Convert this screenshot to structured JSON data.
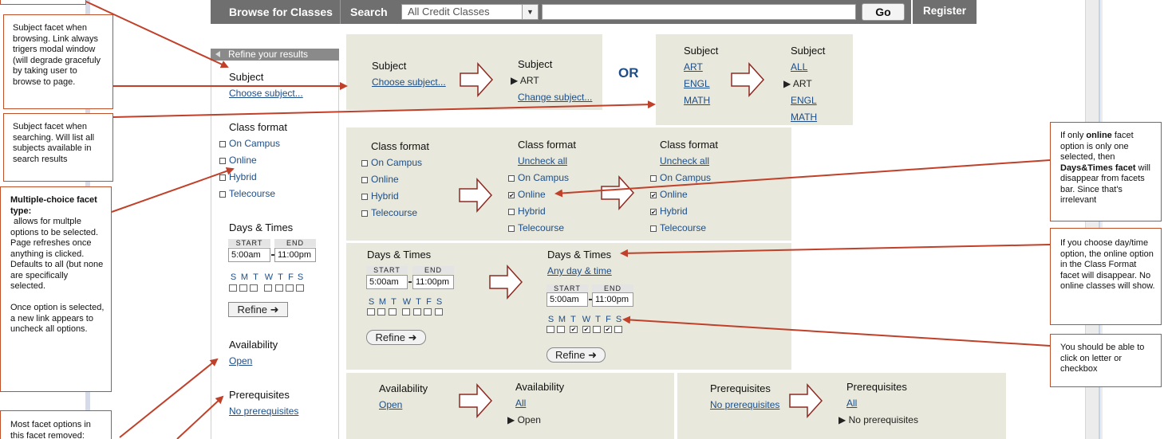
{
  "topbar": {
    "browse": "Browse for Classes",
    "search": "Search",
    "select_value": "All Credit Classes",
    "go": "Go",
    "register": "Register"
  },
  "sidebar": {
    "header": "Refine your results",
    "subject_title": "Subject",
    "subject_link": "Choose subject...",
    "class_format_title": "Class format",
    "formats": [
      "On Campus",
      "Online",
      "Hybrid",
      "Telecourse"
    ],
    "days_title": "Days & Times",
    "start_label": "START",
    "end_label": "END",
    "start_value": "5:00am",
    "end_value": "11:00pm",
    "days": [
      "S",
      "M",
      "T",
      "W",
      "T",
      "F",
      "S"
    ],
    "refine": "Refine",
    "availability_title": "Availability",
    "availability_link": "Open",
    "prereq_title": "Prerequisites",
    "prereq_link": "No prerequisites"
  },
  "subject_panel_a": {
    "left_title": "Subject",
    "left_link": "Choose subject...",
    "right_title": "Subject",
    "right_selected": "ART",
    "right_link": "Change subject..."
  },
  "or_label": "OR",
  "subject_panel_b": {
    "left_title": "Subject",
    "left_links": [
      "ART",
      "ENGL",
      "MATH"
    ],
    "right_title": "Subject",
    "right_all": "ALL",
    "right_selected": "ART",
    "right_links": [
      "ENGL",
      "MATH"
    ]
  },
  "format_panel": {
    "col1_title": "Class format",
    "col1_options": [
      "On Campus",
      "Online",
      "Hybrid",
      "Telecourse"
    ],
    "col2_title": "Class format",
    "col2_uncheck": "Uncheck all",
    "col2_options": [
      "On Campus",
      "Online",
      "Hybrid",
      "Telecourse"
    ],
    "col3_title": "Class format",
    "col3_uncheck": "Uncheck all",
    "col3_options": [
      "On Campus",
      "Online",
      "Hybrid",
      "Telecourse"
    ]
  },
  "days_panel": {
    "left_title": "Days & Times",
    "right_title": "Days & Times",
    "right_link": "Any day & time",
    "start_label": "START",
    "end_label": "END",
    "start_value": "5:00am",
    "end_value": "11:00pm",
    "days": [
      "S",
      "M",
      "T",
      "W",
      "T",
      "F",
      "S"
    ],
    "refine": "Refine"
  },
  "availability_panel": {
    "left_title": "Availability",
    "left_link": "Open",
    "right_title": "Availability",
    "right_link": "All",
    "right_selected": "Open"
  },
  "prereq_panel": {
    "left_title": "Prerequisites",
    "left_link": "No prerequisites",
    "right_title": "Prerequisites",
    "right_link": "All",
    "right_selected": "No prerequisites"
  },
  "notes": {
    "browsing": "Subject facet when browsing. Link always trigers modal window (will degrade gracefuly by taking user to browse to page.",
    "searching": "Subject facet when searching. Will list all subjects available in search results",
    "multiple_title": "Multiple-choice facet type:",
    "multiple_body": "allows for multple options to be selected. Page refreshes once anything is clicked. Defaults to all (but none are specifically selected.",
    "multiple_body2": "Once option is selected, a new link appears to uncheck all options.",
    "most_removed": "Most facet options in this facet removed:",
    "online_pre": "If only ",
    "online_bold": "online",
    "online_mid": " facet option is only one selected, then ",
    "online_bold2": "Days&Times facet",
    "online_post": " will disappear from facets bar. Since that's irrelevant",
    "daytime": "If you choose day/time option, the online option in the Class Format facet will disappear. No online classes will show.",
    "clickable": "You should be able to click on letter or checkbox"
  }
}
